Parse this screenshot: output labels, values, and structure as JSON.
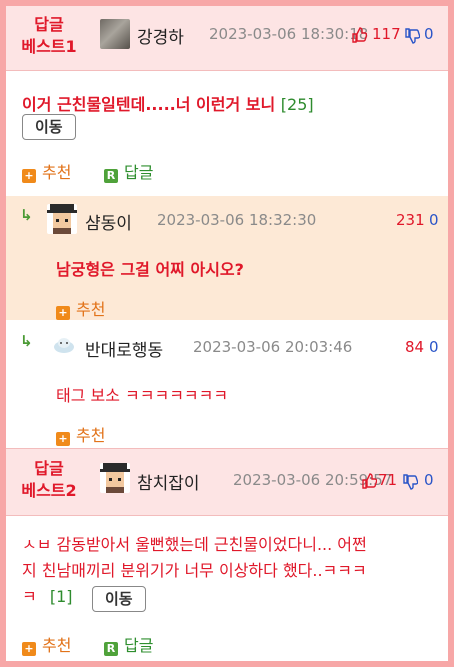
{
  "best1": {
    "label_line1": "답글",
    "label_line2": "베스트1",
    "nick": "강경하",
    "date": "2023-03-06 18:30:18",
    "up": "117",
    "down": "0",
    "text": "이거 근친물일텐데.....너 이런거 보니",
    "count": "[25]",
    "move": "이동",
    "recommend": "추천",
    "reply": "답글"
  },
  "reply1": {
    "nick": "샴동이",
    "date": "2023-03-06 18:32:30",
    "up": "231",
    "down": "0",
    "text": "남궁형은 그걸 어찌 아시오?",
    "recommend": "추천"
  },
  "reply2": {
    "nick": "반대로행동",
    "date": "2023-03-06 20:03:46",
    "up": "84",
    "down": "0",
    "text": "태그 보소 ㅋㅋㅋㅋㅋㅋㅋ",
    "recommend": "추천"
  },
  "best2": {
    "label_line1": "답글",
    "label_line2": "베스트2",
    "nick": "참치잡이",
    "date": "2023-03-06 20:59:57",
    "up": "71",
    "down": "0",
    "text_line1": "ㅅㅂ 감동받아서 울뻔했는데 근친물이었다니... 어쩐",
    "text_line2": "지 친남매끼리 분위기가 너무 이상하다 했다..ㅋㅋㅋ",
    "text_line3": "ㅋ",
    "count": "[1]",
    "move": "이동",
    "recommend": "추천",
    "reply": "답글"
  },
  "icons": {
    "thumb_up": "thumbs-up-icon",
    "thumb_down": "thumbs-down-icon",
    "reply_arrow": "reply-arrow-icon",
    "plus": "plus-square-icon",
    "r": "r-square-icon"
  },
  "colors": {
    "accent_red": "#e0182a",
    "down_blue": "#2a55c8",
    "reply_bg": "#fde9d6",
    "header_bg": "#fde4e4",
    "frame": "#f7a7a7"
  }
}
